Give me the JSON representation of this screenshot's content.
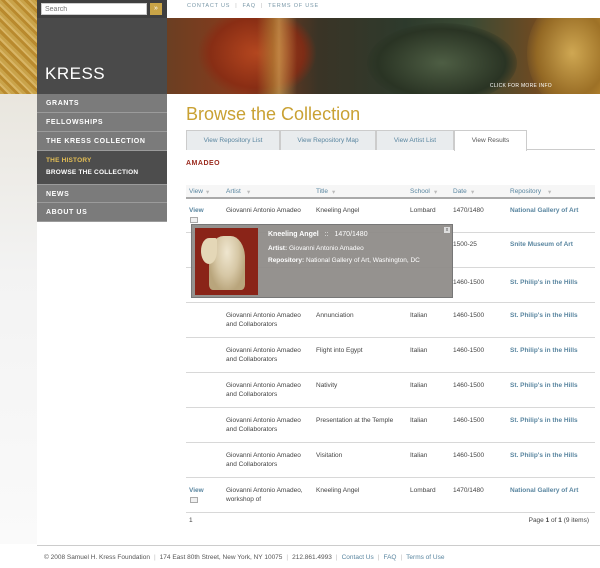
{
  "search": {
    "placeholder": "Search",
    "button": "»"
  },
  "logo": "KRESS",
  "nav": {
    "items": [
      "GRANTS",
      "FELLOWSHIPS",
      "THE KRESS COLLECTION"
    ],
    "sub_items": [
      "THE HISTORY",
      "BROWSE THE COLLECTION"
    ],
    "more_items": [
      "NEWS",
      "ABOUT US"
    ]
  },
  "toplinks": [
    "CONTACT US",
    "FAQ",
    "TERMS OF USE"
  ],
  "banner": {
    "more_info": "CLICK FOR MORE INFO"
  },
  "page_title": "Browse the Collection",
  "tabs": [
    "View Repository List",
    "View Repository Map",
    "View Artist List",
    "View Results"
  ],
  "artist_heading": "AMADEO",
  "table": {
    "headers": [
      "View",
      "Artist",
      "Title",
      "School",
      "Date",
      "Repository"
    ],
    "rows": [
      {
        "view": "View",
        "artist": "Giovanni Antonio Amadeo",
        "title": "Kneeling Angel",
        "school": "Lombard",
        "date": "1470/1480",
        "repository": "National Gallery of Art"
      },
      {
        "view": "",
        "artist": "",
        "title": "",
        "school": "",
        "date": "1500-25",
        "repository": "Snite Museum of Art"
      },
      {
        "view": "",
        "artist": "",
        "title": "",
        "school": "",
        "date": "1460-1500",
        "repository": "St. Philip's in the Hills"
      },
      {
        "view": "",
        "artist": "Giovanni Antonio Amadeo and Collaborators",
        "title": "Annunciation",
        "school": "Italian",
        "date": "1460-1500",
        "repository": "St. Philip's in the Hills"
      },
      {
        "view": "",
        "artist": "Giovanni Antonio Amadeo and Collaborators",
        "title": "Flight into Egypt",
        "school": "Italian",
        "date": "1460-1500",
        "repository": "St. Philip's in the Hills"
      },
      {
        "view": "",
        "artist": "Giovanni Antonio Amadeo and Collaborators",
        "title": "Nativity",
        "school": "Italian",
        "date": "1460-1500",
        "repository": "St. Philip's in the Hills"
      },
      {
        "view": "",
        "artist": "Giovanni Antonio Amadeo and Collaborators",
        "title": "Presentation at the Temple",
        "school": "Italian",
        "date": "1460-1500",
        "repository": "St. Philip's in the Hills"
      },
      {
        "view": "",
        "artist": "Giovanni Antonio Amadeo and Collaborators",
        "title": "Visitation",
        "school": "Italian",
        "date": "1460-1500",
        "repository": "St. Philip's in the Hills"
      },
      {
        "view": "View",
        "artist": "Giovanni Antonio Amadeo, workshop of",
        "title": "Kneeling Angel",
        "school": "Lombard",
        "date": "1470/1480",
        "repository": "National Gallery of Art"
      }
    ],
    "footer_left": "1",
    "page_prefix": "Page",
    "page_num": "1",
    "page_of": "of",
    "page_total": "1",
    "items_count": "(9 items)"
  },
  "popup": {
    "title": "Kneeling Angel",
    "separator": "::",
    "date": "1470/1480",
    "artist_label": "Artist:",
    "artist": "Giovanni Antonio Amadeo",
    "repository_label": "Repository:",
    "repository": "National Gallery of Art, Washington, DC",
    "close": "x"
  },
  "footer": {
    "copyright": "© 2008 Samuel H. Kress Foundation",
    "address": "174 East 80th Street, New York, NY 10075",
    "phone": "212.861.4993",
    "links": [
      "Contact Us",
      "FAQ",
      "Terms of Use"
    ]
  },
  "colors": {
    "accent_gold": "#c9a133",
    "link_blue": "#5a86a0",
    "artist_red": "#9b2b1f"
  }
}
